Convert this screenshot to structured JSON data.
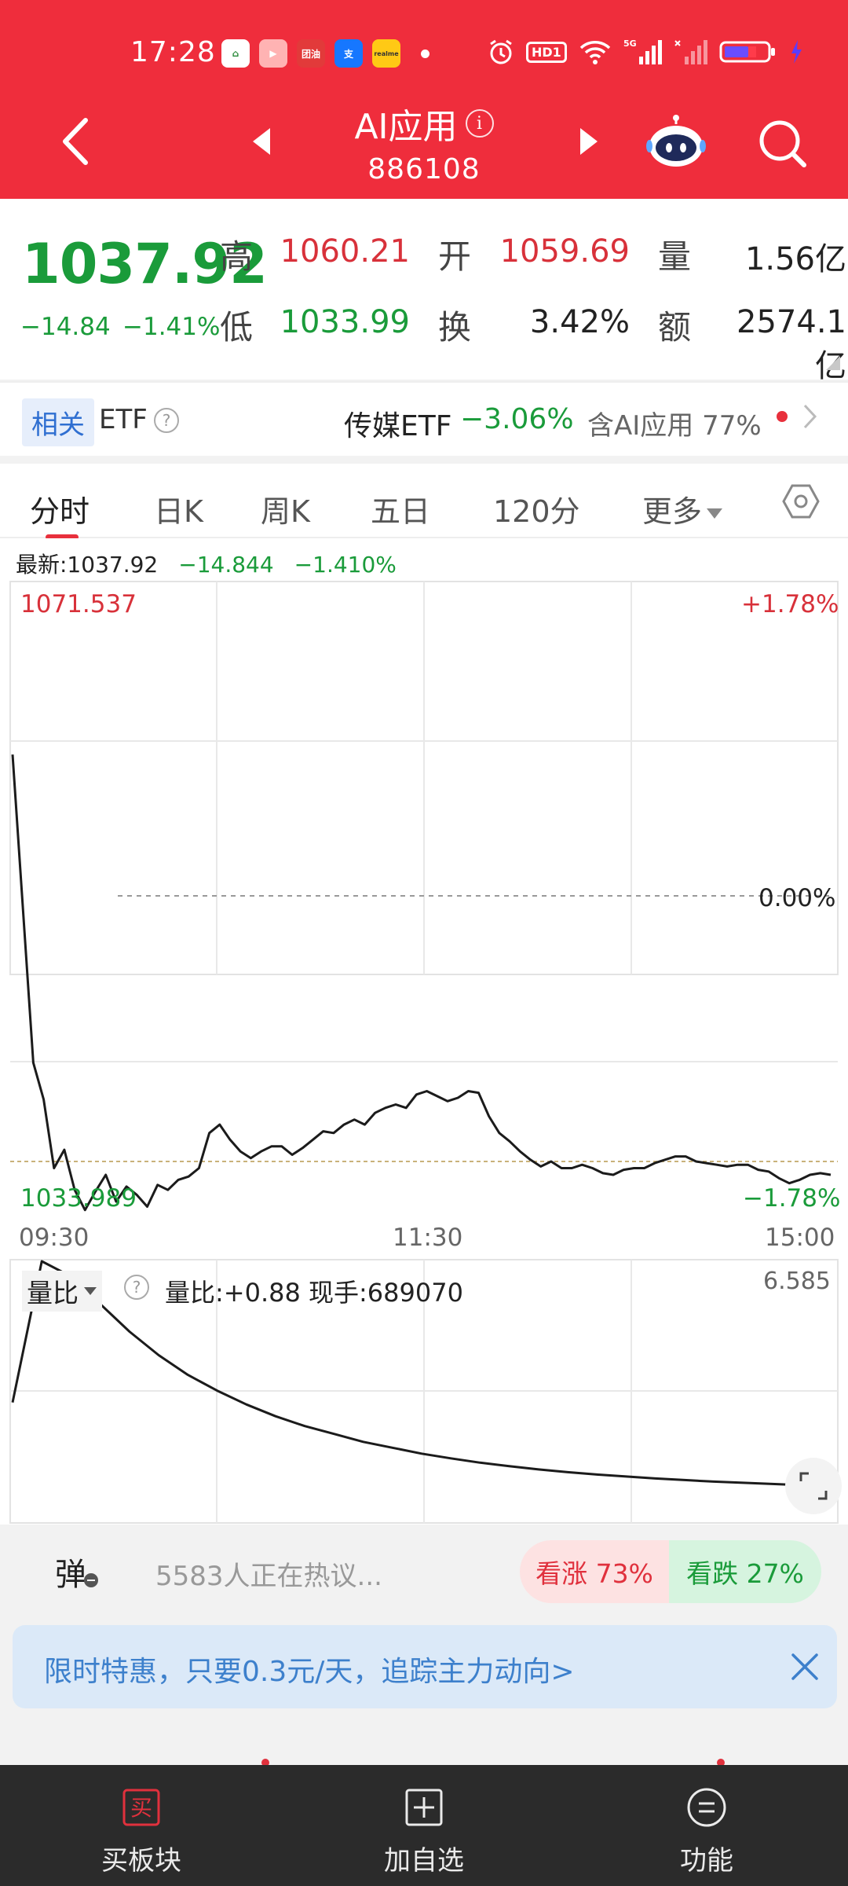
{
  "status_bar": {
    "time": "17:28",
    "apps": [
      {
        "name": "home-app-icon",
        "color": "#ffffff",
        "text": "⌂"
      },
      {
        "name": "video-app-icon",
        "color": "#ffb3b3",
        "text": "▶"
      },
      {
        "name": "tuanyou-app-icon",
        "color": "#e23a3a",
        "text": "团油"
      },
      {
        "name": "alipay-app-icon",
        "color": "#1677ff",
        "text": "支"
      },
      {
        "name": "realme-app-icon",
        "color": "#ffc915",
        "text": "realme"
      }
    ],
    "hd_label": "HD1",
    "network_label": "5G"
  },
  "header": {
    "title": "AI应用",
    "code": "886108",
    "colors": {
      "bg": "#ef2d3c"
    }
  },
  "quote": {
    "price": "1037.92",
    "change": "−14.84",
    "change_pct": "−1.41%",
    "labels": {
      "high": "高",
      "low": "低",
      "open": "开",
      "turnover": "换",
      "volume": "量",
      "amount": "额"
    },
    "high": "1060.21",
    "low": "1033.99",
    "open": "1059.69",
    "turnover": "3.42%",
    "volume": "1.56亿",
    "amount": "2574.1亿"
  },
  "etf": {
    "tag": "相关",
    "label": "ETF",
    "help": "?",
    "name": "传媒ETF",
    "value": "−3.06%",
    "include": "含AI应用",
    "include_pct": "77%"
  },
  "tabs": [
    {
      "label": "分时",
      "active": true
    },
    {
      "label": "日K"
    },
    {
      "label": "周K"
    },
    {
      "label": "五日"
    },
    {
      "label": "120分"
    },
    {
      "label": "更多"
    }
  ],
  "chart_header": {
    "latest_label": "最新:1037.92",
    "latest_change": "−14.844",
    "latest_pct": "−1.410%"
  },
  "chart_data": {
    "type": "line",
    "price_axis": {
      "max": "1071.537",
      "min": "1033.989",
      "pct_max": "+1.78%",
      "pct_mid": "0.00%",
      "pct_min": "−1.78%"
    },
    "x_labels": [
      "09:30",
      "11:30",
      "15:00"
    ],
    "ylim": [
      1033.989,
      1071.537
    ],
    "reference_line": 1052.763,
    "avg_line": 1036.9,
    "series": [
      {
        "values": [
          1061.2,
          1052,
          1042.8,
          1040.6,
          1036.5,
          1037.6,
          1035.2,
          1034,
          1035.1,
          1036.1,
          1034.5,
          1035.4,
          1034.9,
          1034.2,
          1035.5,
          1035.2,
          1035.8,
          1036,
          1036.5,
          1038.6,
          1039.1,
          1038.2,
          1037.5,
          1037.1,
          1037.5,
          1037.8,
          1037.8,
          1037.3,
          1037.7,
          1038.2,
          1038.7,
          1038.6,
          1039.1,
          1039.4,
          1039.1,
          1039.8,
          1040.1,
          1040.3,
          1040.1,
          1040.9,
          1041.1,
          1040.8,
          1040.5,
          1040.7,
          1041.1,
          1041,
          1039.6,
          1038.6,
          1038.1,
          1037.5,
          1037,
          1036.6,
          1036.9,
          1036.5,
          1036.5,
          1036.7,
          1036.5,
          1036.2,
          1036.1,
          1036.4,
          1036.5,
          1036.5,
          1036.8,
          1037,
          1037.2,
          1037.2,
          1036.9,
          1036.8,
          1036.7,
          1036.6,
          1036.7,
          1036.7,
          1036.4,
          1036.3,
          1035.9,
          1035.6,
          1035.8,
          1036.1,
          1036.2,
          1036.1
        ]
      }
    ]
  },
  "volume_ratio": {
    "label": "量比",
    "info": "量比:+0.88  现手:689070",
    "max": "6.585",
    "values": [
      3.0,
      6.585,
      6.2,
      5.5,
      4.8,
      4.2,
      3.7,
      3.3,
      2.95,
      2.65,
      2.4,
      2.2,
      2.0,
      1.85,
      1.7,
      1.58,
      1.47,
      1.38,
      1.3,
      1.23,
      1.17,
      1.12,
      1.07,
      1.03,
      0.99,
      0.96,
      0.93,
      0.9,
      0.88
    ]
  },
  "discussion": {
    "tan": "弹",
    "text": "5583人正在热议...",
    "bull": "看涨 73%",
    "bear": "看跌 27%"
  },
  "banner": {
    "text": "限时特惠，只要0.3元/天，追踪主力动向>"
  },
  "nav": [
    {
      "label": "买板块",
      "icon": "买"
    },
    {
      "label": "加自选",
      "icon": "+"
    },
    {
      "label": "功能",
      "icon": "="
    }
  ]
}
